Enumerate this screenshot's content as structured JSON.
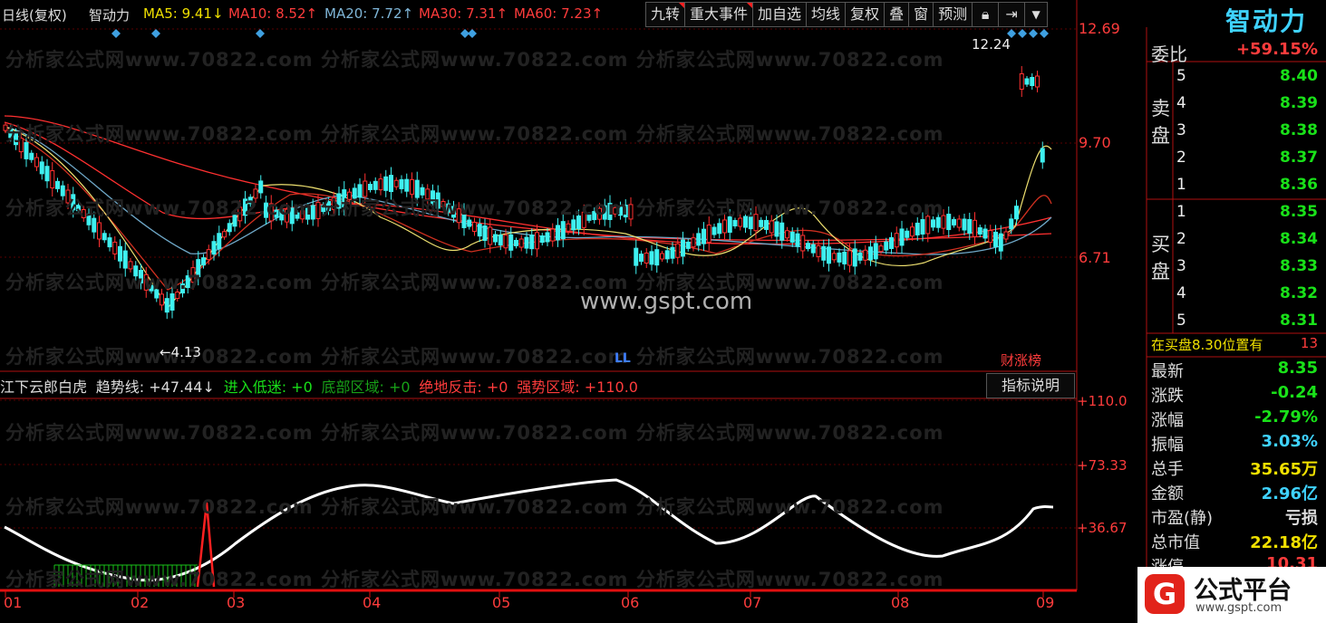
{
  "header": {
    "period": "日线(复权)",
    "name": "智动力",
    "ma5": "MA5: 9.41↓",
    "ma10": "MA10: 8.52↑",
    "ma20": "MA20: 7.72↑",
    "ma30": "MA30: 7.31↑",
    "ma60": "MA60: 7.23↑"
  },
  "toolbar": [
    "九转",
    "重大事件",
    "加自选",
    "均线",
    "复权",
    "叠",
    "窗",
    "预测"
  ],
  "toolbar_icons": [
    "lock-icon",
    "pin-right-icon",
    "dropdown-icon"
  ],
  "price_axis": [
    "12.69",
    "9.70",
    "6.71"
  ],
  "annotations": {
    "high": "12.24",
    "low": "4.13",
    "ll": "LL",
    "ranking": "财涨榜"
  },
  "watermark_text": "分析家公式网www.70822.com",
  "center_watermark": "www.gspt.com",
  "oscillator": {
    "title": "江下云郎白虎",
    "trend": "趋势线: +47.44↓",
    "enter": "进入低迷: +0",
    "bottom": "底部区域: +0",
    "counter": "绝地反击: +0",
    "strong": "强势区域: +110.0",
    "axis": [
      "+110.0",
      "+73.33",
      "+36.67"
    ],
    "button": "指标说明"
  },
  "months": [
    "01",
    "02",
    "03",
    "04",
    "05",
    "06",
    "07",
    "08",
    "09"
  ],
  "right_panel": {
    "brand": "智动力",
    "weibi_label": "委比",
    "weibi_value": "+59.15%",
    "sell_side": "卖盘",
    "buy_side": "买盘",
    "sells": [
      [
        "5",
        "8.40"
      ],
      [
        "4",
        "8.39"
      ],
      [
        "3",
        "8.38"
      ],
      [
        "2",
        "8.37"
      ],
      [
        "1",
        "8.36"
      ]
    ],
    "buys": [
      [
        "1",
        "8.35"
      ],
      [
        "2",
        "8.34"
      ],
      [
        "3",
        "8.33"
      ],
      [
        "4",
        "8.32"
      ],
      [
        "5",
        "8.31"
      ]
    ],
    "notice": "在买盘8.30位置有",
    "notice_num": "13",
    "stats": [
      {
        "k": "最新",
        "v": "8.35",
        "c": "#19e119"
      },
      {
        "k": "涨跌",
        "v": "-0.24",
        "c": "#19e119"
      },
      {
        "k": "涨幅",
        "v": "-2.79%",
        "c": "#19e119"
      },
      {
        "k": "振幅",
        "v": "3.03%",
        "c": "#3fd2ff"
      },
      {
        "k": "总手",
        "v": "35.65万",
        "c": "#f0e000"
      },
      {
        "k": "金额",
        "v": "2.96亿",
        "c": "#3fd2ff"
      },
      {
        "k": "市盈(静)",
        "v": "亏损",
        "c": "#dddddd"
      },
      {
        "k": "总市值",
        "v": "22.18亿",
        "c": "#f0e000"
      },
      {
        "k": "涨停",
        "v": "10.31",
        "c": "#ff3c3c"
      }
    ]
  },
  "logo": {
    "mark": "G",
    "title": "公式平台",
    "url": "www.gspt.com"
  }
}
